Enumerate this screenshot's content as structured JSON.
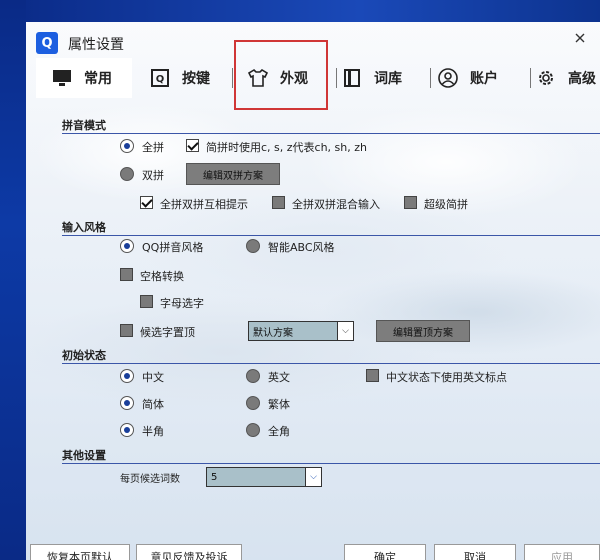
{
  "window": {
    "title": "属性设置",
    "logo_letter": "Q"
  },
  "tabs": [
    {
      "label": "常用",
      "icon": "monitor-icon"
    },
    {
      "label": "按键",
      "icon": "key-icon"
    },
    {
      "label": "外观",
      "icon": "tshirt-icon"
    },
    {
      "label": "词库",
      "icon": "book-icon"
    },
    {
      "label": "账户",
      "icon": "account-icon"
    },
    {
      "label": "高级",
      "icon": "gear-icon"
    }
  ],
  "pinyin_mode": {
    "title": "拼音模式",
    "full_label": "全拼",
    "shorthand_label": "简拼时使用c, s, z代表ch, sh, zh",
    "double_label": "双拼",
    "edit_double_button": "编辑双拼方案",
    "hint_label": "全拼双拼互相提示",
    "mixed_label": "全拼双拼混合输入",
    "super_label": "超级简拼"
  },
  "input_style": {
    "title": "输入风格",
    "qq_label": "QQ拼音风格",
    "abc_label": "智能ABC风格",
    "space_label": "空格转换",
    "letter_label": "字母选字",
    "top_label": "候选字置顶",
    "scheme_select": "默认方案",
    "edit_top_button": "编辑置顶方案"
  },
  "initial_state": {
    "title": "初始状态",
    "chinese_label": "中文",
    "english_label": "英文",
    "punct_label": "中文状态下使用英文标点",
    "simplified_label": "简体",
    "traditional_label": "繁体",
    "half_label": "半角",
    "full_label": "全角"
  },
  "other": {
    "title": "其他设置",
    "candidates_label": "每页候选词数",
    "candidates_value": "5"
  },
  "footer": {
    "restore_button": "恢复本页默认",
    "feedback_button": "意见反馈及投诉",
    "ok_button": "确定",
    "cancel_button": "取消",
    "apply_button": "应用"
  }
}
